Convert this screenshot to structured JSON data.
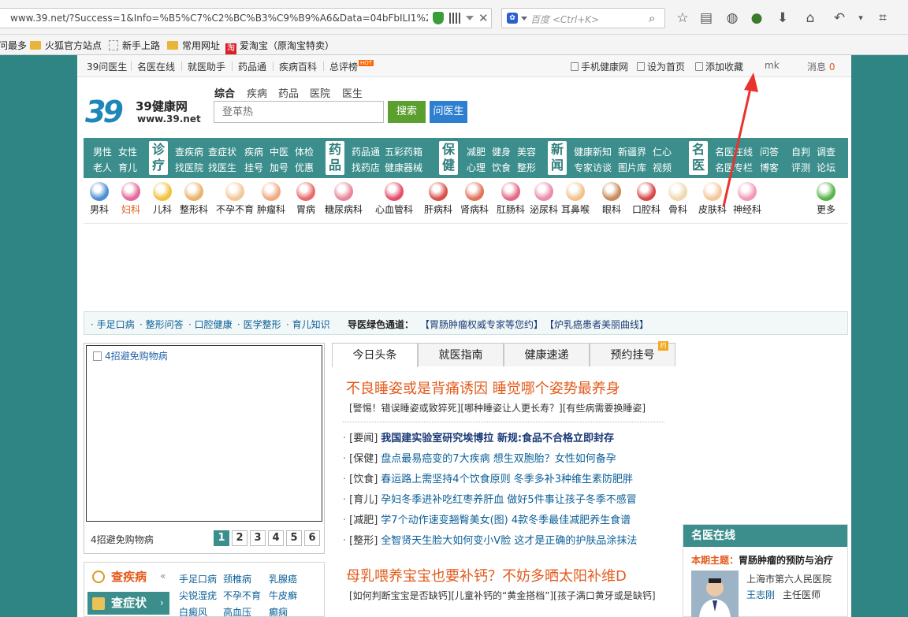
{
  "browser": {
    "url": "www.39.net/?Success=1&Info=%B5%C7%C2%BC%B3%C9%B9%A6&Data=04bFbILI1%2ftU9",
    "search_placeholder": "百度 <Ctrl+K>",
    "icons": [
      "star-icon",
      "reader-icon",
      "palette-icon",
      "addon-icon",
      "download-icon",
      "home-icon",
      "back-icon",
      "menu-icon",
      "crop-icon"
    ]
  },
  "bookmarks": [
    "问最多",
    "火狐官方站点",
    "新手上路",
    "常用网址",
    "爱淘宝（原淘宝特卖）"
  ],
  "topnav": {
    "left": [
      "39问医生",
      "名医在线",
      "就医助手",
      "药品通",
      "疾病百科",
      "总评榜"
    ],
    "hot": "HOT",
    "right": [
      "手机健康网",
      "设为首页",
      "添加收藏"
    ],
    "user": "mk",
    "msg_label": "消息",
    "msg_count": "0"
  },
  "logo": {
    "mark": "39",
    "name": "39健康网",
    "url": "www.39.net"
  },
  "search": {
    "tabs": [
      "综合",
      "疾病",
      "药品",
      "医院",
      "医生"
    ],
    "placeholder": "登革热",
    "search_btn": "搜索",
    "ask_btn": "问医生"
  },
  "catbar": {
    "g1_row1": [
      "男性",
      "女性"
    ],
    "g1_row2": [
      "老人",
      "育儿"
    ],
    "g2_badge": [
      "诊",
      "疗"
    ],
    "g2_row1": [
      "查疾病",
      "查症状",
      "疾病",
      "中医",
      "体检"
    ],
    "g2_row2": [
      "找医院",
      "找医生",
      "挂号",
      "加号",
      "优惠"
    ],
    "g3_badge": [
      "药",
      "品"
    ],
    "g3_row1": [
      "药品通",
      "五彩药箱"
    ],
    "g3_row2": [
      "找药店",
      "健康器械"
    ],
    "g4_badge": [
      "保",
      "健"
    ],
    "g4_row1": [
      "减肥",
      "健身",
      "美容"
    ],
    "g4_row2": [
      "心理",
      "饮食",
      "整形"
    ],
    "g5_badge": [
      "新",
      "闻"
    ],
    "g5_row1": [
      "健康新知",
      "新疆界",
      "仁心"
    ],
    "g5_row2": [
      "专家访谈",
      "图片库",
      "视频"
    ],
    "g6_badge": [
      "名",
      "医"
    ],
    "g6_row1": [
      "名医在线",
      "问答",
      "自判",
      "调查"
    ],
    "g6_row2": [
      "名医专栏",
      "博客",
      "评测",
      "论坛"
    ]
  },
  "departments": [
    {
      "label": "男科",
      "color": "#4d8ed1"
    },
    {
      "label": "妇科",
      "color": "#e36a9a",
      "highlight": true
    },
    {
      "label": "儿科",
      "color": "#f0c23e"
    },
    {
      "label": "整形科",
      "color": "#e8b36a"
    },
    {
      "label": "不孕不育",
      "color": "#f3c79a"
    },
    {
      "label": "肿瘤科",
      "color": "#f0a986"
    },
    {
      "label": "胃病",
      "color": "#e96a6a"
    },
    {
      "label": "糖尿病科",
      "color": "#e8879a"
    },
    {
      "label": "心血管科",
      "color": "#e24e6a"
    },
    {
      "label": "肝病科",
      "color": "#d9504a"
    },
    {
      "label": "肾病科",
      "color": "#e0735a"
    },
    {
      "label": "肛肠科",
      "color": "#e36a88"
    },
    {
      "label": "泌尿科",
      "color": "#e88cb0"
    },
    {
      "label": "耳鼻喉",
      "color": "#f1c28c"
    },
    {
      "label": "眼科",
      "color": "#c98a5a"
    },
    {
      "label": "口腔科",
      "color": "#d94848"
    },
    {
      "label": "骨科",
      "color": "#efd9b0"
    },
    {
      "label": "皮肤科",
      "color": "#f2c89c"
    },
    {
      "label": "神经科",
      "color": "#f19ab8"
    },
    {
      "label": "更多",
      "color": "#56b54a"
    }
  ],
  "notice": {
    "links": [
      "手足口病",
      "整形问答",
      "口腔健康",
      "医学整形",
      "育儿知识"
    ],
    "label": "导医绿色通道：",
    "promo1": "【胃肠肿瘤权威专家等您约】",
    "promo2": "【炉乳癌患者美丽曲线】"
  },
  "leftbox": {
    "title": "4招避免购物病",
    "caption": "4招避免购物病",
    "pages": [
      "1",
      "2",
      "3",
      "4",
      "5",
      "6"
    ]
  },
  "lookup": {
    "tab1": "查疾病",
    "tab2": "查症状",
    "row1": [
      "手足口病",
      "颈椎病",
      "乳腺癌"
    ],
    "row2": [
      "尖锐湿疣",
      "不孕不育",
      "牛皮癣"
    ],
    "row3": [
      "白癜风",
      "高血压",
      "癫痫"
    ]
  },
  "news": {
    "tabs": [
      "今日头条",
      "就医指南",
      "健康速递",
      "预约挂号"
    ],
    "yue": "约",
    "headline": "不良睡姿或是背痛诱因  睡觉哪个姿势最养身",
    "subline": "[警惕！错误睡姿或致猝死][哪种睡姿让人更长寿？][有些病需要换睡姿]",
    "items": [
      {
        "tag": "[要闻]",
        "text": "我国建实验室研究埃博拉  新规:食品不合格立即封存",
        "bold": true
      },
      {
        "tag": "[保健]",
        "text": "盘点最易癌变的7大疾病  想生双胞胎？女性如何备孕"
      },
      {
        "tag": "[饮食]",
        "text": "春运路上需坚持4个饮食原则  冬季多补3种维生素防肥胖"
      },
      {
        "tag": "[育儿]",
        "text": "孕妇冬季进补吃红枣养肝血  做好5件事让孩子冬季不感冒"
      },
      {
        "tag": "[减肥]",
        "text": "学7个动作速变翘臀美女(图)  4款冬季最佳减肥养生食谱"
      },
      {
        "tag": "[整形]",
        "text": "全智贤天生脸大如何变小V脸  这才是正确的护肤品涂抹法"
      }
    ],
    "headline2": "母乳喂养宝宝也要补钙？不妨多晒太阳补维D",
    "subline2": "[如何判断宝宝是否缺钙][儿童补钙的“黄金搭档”][孩子满口黄牙或是缺钙]"
  },
  "doctor": {
    "title": "名医在线",
    "theme_label": "本期主题：",
    "theme": "胃肠肿瘤的预防与治疗",
    "hospital": "上海市第六人民医院",
    "name": "王志刚",
    "role": "主任医师"
  },
  "colors": {
    "teal": "#3b8e8c",
    "orange": "#e35b1c",
    "link": "#0b5f97",
    "annotation": "#e8332d"
  }
}
